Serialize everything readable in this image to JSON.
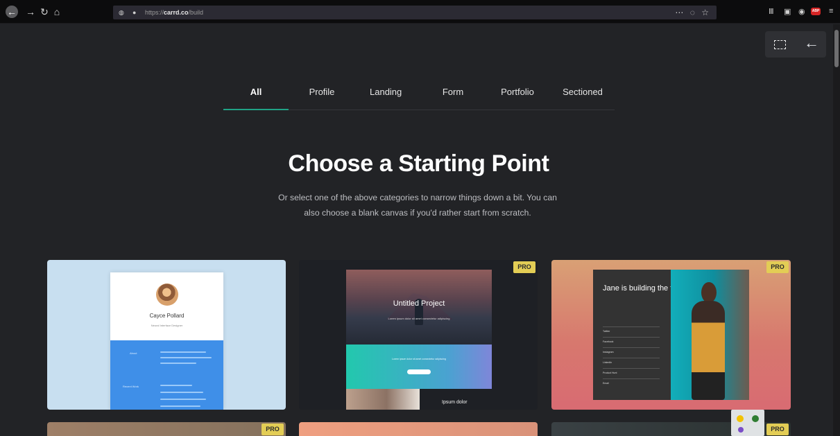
{
  "browser": {
    "url_prefix": "https://",
    "url_host": "carrd.co",
    "url_path": "/build",
    "nav_icons": [
      "back-icon",
      "forward-icon",
      "reload-icon",
      "home-icon"
    ],
    "url_icons": [
      "shield-icon",
      "lock-icon",
      "more-icon",
      "pocket-icon",
      "star-icon"
    ],
    "toolbar_icons": [
      "library-icon",
      "sidebar-icon",
      "account-icon",
      "adblock-icon",
      "menu-icon"
    ],
    "adblock_label": "ABP"
  },
  "editor": {
    "select_icon": "selection-box-icon",
    "back_icon": "back-arrow-icon"
  },
  "tabs": [
    {
      "label": "All",
      "active": true
    },
    {
      "label": "Profile",
      "active": false
    },
    {
      "label": "Landing",
      "active": false
    },
    {
      "label": "Form",
      "active": false
    },
    {
      "label": "Portfolio",
      "active": false
    },
    {
      "label": "Sectioned",
      "active": false
    }
  ],
  "hero": {
    "title": "Choose a Starting Point",
    "subtitle": "Or select one of the above categories to narrow things down a bit. You can also choose a blank canvas if you'd rather start from scratch."
  },
  "templates": [
    {
      "name": "Cayce Pollard",
      "role": "Neural Interface Designer",
      "about_label": "About",
      "recent_label": "Recent Work",
      "pro": false
    },
    {
      "name": "Untitled Project",
      "lead": "Lorem ipsum dolor sit amet consectetur adipiscing",
      "section_label": "Ipsum dolor",
      "pro": true
    },
    {
      "name": "Jane is building the future",
      "links": [
        "Twitter",
        "Facebook",
        "Instagram",
        "LinkedIn",
        "Product Hunt",
        "Email"
      ],
      "pro": true
    }
  ],
  "bottom_row_badges": [
    "PRO",
    "PRO"
  ],
  "badge_label": "PRO"
}
